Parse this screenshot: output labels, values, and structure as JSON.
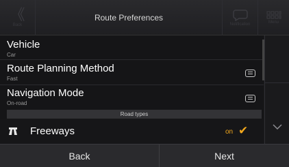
{
  "header": {
    "back_label": "Back",
    "title": "Route Preferences",
    "notification_label": "Notification",
    "menu_label": "Menu"
  },
  "rows": [
    {
      "label": "Vehicle",
      "sub": "Car"
    },
    {
      "label": "Route Planning Method",
      "sub": "Fast"
    },
    {
      "label": "Navigation Mode",
      "sub": "On-road"
    }
  ],
  "section_header": "Road types",
  "freeways": {
    "label": "Freeways",
    "state": "on"
  },
  "footer": {
    "back_label": "Back",
    "next_label": "Next"
  },
  "colors": {
    "accent": "#f2a81d"
  },
  "icons": {
    "back": "chevron-left-icon",
    "notification": "speech-bubble-icon",
    "menu": "grid-icon",
    "settings": "list-icon",
    "road": "freeway-icon",
    "check": "checkmark-icon",
    "scroll_down": "chevron-down-icon"
  }
}
